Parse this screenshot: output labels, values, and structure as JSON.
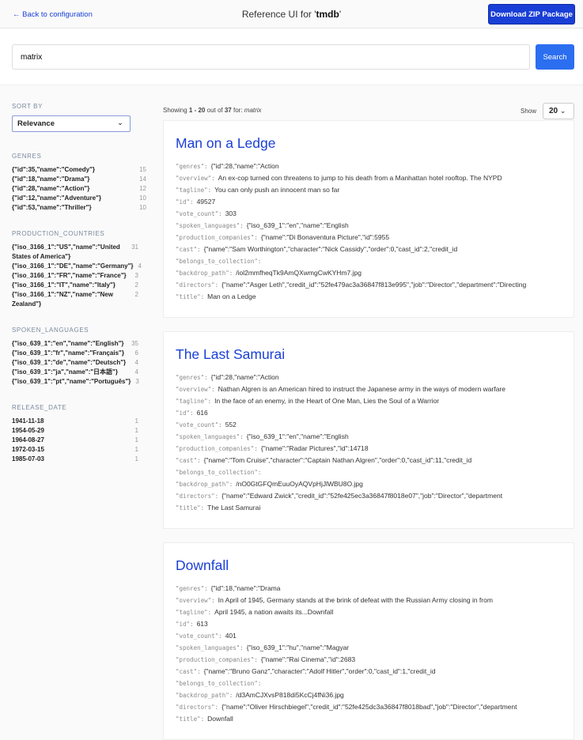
{
  "header": {
    "back": "← Back to configuration",
    "title_prefix": "Reference UI for '",
    "title_name": "tmdb",
    "title_suffix": "'",
    "download": "Download ZIP Package"
  },
  "search": {
    "value": "matrix",
    "button": "Search"
  },
  "sidebar": {
    "sort_label": "SORT BY",
    "sort_value": "Relevance",
    "facets": [
      {
        "label": "GENRES",
        "items": [
          {
            "t": "{\"id\":35,\"name\":\"Comedy\"}",
            "n": "15"
          },
          {
            "t": "{\"id\":18,\"name\":\"Drama\"}",
            "n": "14"
          },
          {
            "t": "{\"id\":28,\"name\":\"Action\"}",
            "n": "12"
          },
          {
            "t": "{\"id\":12,\"name\":\"Adventure\"}",
            "n": "10"
          },
          {
            "t": "{\"id\":53,\"name\":\"Thriller\"}",
            "n": "10"
          }
        ]
      },
      {
        "label": "PRODUCTION_COUNTRIES",
        "items": [
          {
            "t": "{\"iso_3166_1\":\"US\",\"name\":\"United States of America\"}",
            "n": "31"
          },
          {
            "t": "{\"iso_3166_1\":\"DE\",\"name\":\"Germany\"}",
            "n": "4"
          },
          {
            "t": "{\"iso_3166_1\":\"FR\",\"name\":\"France\"}",
            "n": "3"
          },
          {
            "t": "{\"iso_3166_1\":\"IT\",\"name\":\"Italy\"}",
            "n": "2"
          },
          {
            "t": "{\"iso_3166_1\":\"NZ\",\"name\":\"New Zealand\"}",
            "n": "2"
          }
        ]
      },
      {
        "label": "SPOKEN_LANGUAGES",
        "items": [
          {
            "t": "{\"iso_639_1\":\"en\",\"name\":\"English\"}",
            "n": "35"
          },
          {
            "t": "{\"iso_639_1\":\"fr\",\"name\":\"Français\"}",
            "n": "6"
          },
          {
            "t": "{\"iso_639_1\":\"de\",\"name\":\"Deutsch\"}",
            "n": "4"
          },
          {
            "t": "{\"iso_639_1\":\"ja\",\"name\":\"日本語\"}",
            "n": "4"
          },
          {
            "t": "{\"iso_639_1\":\"pt\",\"name\":\"Português\"}",
            "n": "3"
          }
        ]
      },
      {
        "label": "RELEASE_DATE",
        "items": [
          {
            "t": "1941-11-18",
            "n": "1"
          },
          {
            "t": "1954-05-29",
            "n": "1"
          },
          {
            "t": "1964-08-27",
            "n": "1"
          },
          {
            "t": "1972-03-15",
            "n": "1"
          },
          {
            "t": "1985-07-03",
            "n": "1"
          }
        ]
      }
    ]
  },
  "results": {
    "showing_prefix": "Showing ",
    "range": "1 - 20",
    "out_of": " out of ",
    "total": "37",
    "for": " for: ",
    "query": "matrix",
    "show_label": "Show",
    "show_value": "20",
    "cards": [
      {
        "title": "Man on a Ledge",
        "fields": [
          [
            "\"genres\":",
            "{\"id\":28,\"name\":\"Action"
          ],
          [
            "\"overview\":",
            "An ex-cop turned con threatens to jump to his death from a Manhattan hotel rooftop. The NYPD"
          ],
          [
            "\"tagline\":",
            "You can only push an innocent man so far"
          ],
          [
            "\"id\":",
            "49527"
          ],
          [
            "\"vote_count\":",
            "303"
          ],
          [
            "\"spoken_languages\":",
            "{\"iso_639_1\":\"en\",\"name\":\"English"
          ],
          [
            "\"production_companies\":",
            "{\"name\":\"Di Bonaventura Picture\",\"id\":5955"
          ],
          [
            "\"cast\":",
            "{\"name\":\"Sam Worthington\",\"character\":\"Nick Cassidy\",\"order\":0,\"cast_id\":2,\"credit_id"
          ],
          [
            "\"belongs_to_collection\":",
            ""
          ],
          [
            "\"backdrop_path\":",
            "/iol2mmfheqTk9AmQXwmgCwKYHm7.jpg"
          ],
          [
            "\"directors\":",
            "{\"name\":\"Asger Leth\",\"credit_id\":\"52fe479ac3a36847f813e995\",\"job\":\"Director\",\"department\":\"Directing"
          ],
          [
            "\"title\":",
            "Man on a Ledge"
          ]
        ]
      },
      {
        "title": "The Last Samurai",
        "fields": [
          [
            "\"genres\":",
            "{\"id\":28,\"name\":\"Action"
          ],
          [
            "\"overview\":",
            "Nathan Algren is an American hired to instruct the Japanese army in the ways of modern warfare"
          ],
          [
            "\"tagline\":",
            "In the face of an enemy, in the Heart of One Man, Lies the Soul of a Warrior"
          ],
          [
            "\"id\":",
            "616"
          ],
          [
            "\"vote_count\":",
            "552"
          ],
          [
            "\"spoken_languages\":",
            "{\"iso_639_1\":\"en\",\"name\":\"English"
          ],
          [
            "\"production_companies\":",
            "{\"name\":\"Radar Pictures\",\"id\":14718"
          ],
          [
            "\"cast\":",
            "{\"name\":\"Tom Cruise\",\"character\":\"Captain Nathan Algren\",\"order\":0,\"cast_id\":11,\"credit_id"
          ],
          [
            "\"belongs_to_collection\":",
            ""
          ],
          [
            "\"backdrop_path\":",
            "/nO0GtGFQmEuuOyAQVpHjJlWBU8O.jpg"
          ],
          [
            "\"directors\":",
            "{\"name\":\"Edward Zwick\",\"credit_id\":\"52fe425ec3a36847f8018e07\",\"job\":\"Director\",\"department"
          ],
          [
            "\"title\":",
            "The Last Samurai"
          ]
        ]
      },
      {
        "title": "Downfall",
        "fields": [
          [
            "\"genres\":",
            "{\"id\":18,\"name\":\"Drama"
          ],
          [
            "\"overview\":",
            "In April of 1945, Germany stands at the brink of defeat with the Russian Army closing in from"
          ],
          [
            "\"tagline\":",
            "April 1945, a nation awaits its...Downfall"
          ],
          [
            "\"id\":",
            "613"
          ],
          [
            "\"vote_count\":",
            "401"
          ],
          [
            "\"spoken_languages\":",
            "{\"iso_639_1\":\"hu\",\"name\":\"Magyar"
          ],
          [
            "\"production_companies\":",
            "{\"name\":\"Rai Cinema\",\"id\":2683"
          ],
          [
            "\"cast\":",
            "{\"name\":\"Bruno Ganz\",\"character\":\"Adolf Hitler\",\"order\":0,\"cast_id\":1,\"credit_id"
          ],
          [
            "\"belongs_to_collection\":",
            ""
          ],
          [
            "\"backdrop_path\":",
            "/d3AmCJXvsP818di5KcCj4fNi36.jpg"
          ],
          [
            "\"directors\":",
            "{\"name\":\"Oliver Hirschbiegel\",\"credit_id\":\"52fe425dc3a36847f8018bad\",\"job\":\"Director\",\"department"
          ],
          [
            "\"title\":",
            "Downfall"
          ]
        ]
      }
    ]
  }
}
